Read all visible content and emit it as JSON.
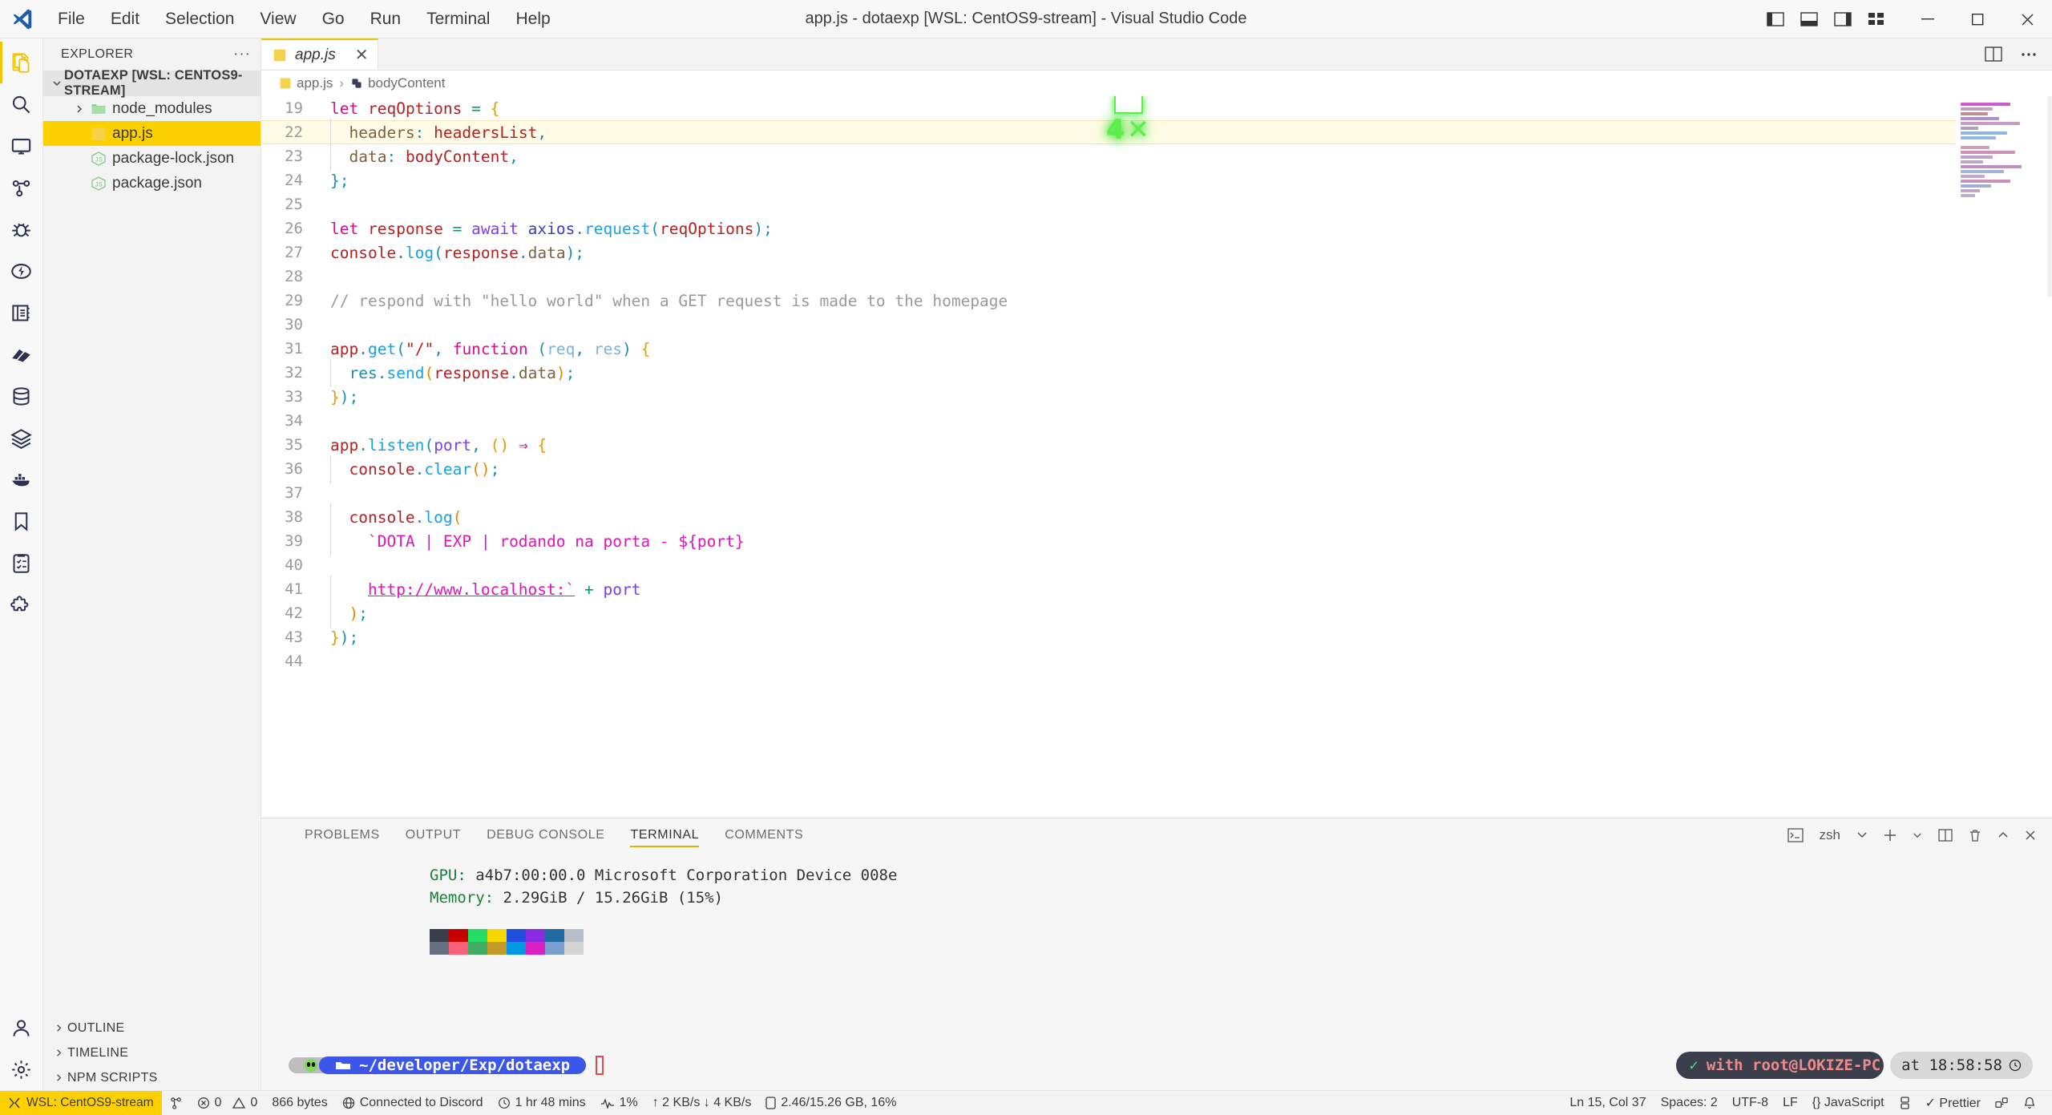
{
  "window": {
    "title": "app.js - dotaexp [WSL: CentOS9-stream] - Visual Studio Code",
    "menu": [
      "File",
      "Edit",
      "Selection",
      "View",
      "Go",
      "Run",
      "Terminal",
      "Help"
    ]
  },
  "activitybar": {
    "items": [
      {
        "name": "explorer-icon",
        "label": "Explorer",
        "active": true
      },
      {
        "name": "search-icon",
        "label": "Search",
        "active": false
      },
      {
        "name": "remote-explorer-icon",
        "label": "Remote Explorer",
        "active": false
      },
      {
        "name": "source-control-icon",
        "label": "Source Control",
        "active": false
      },
      {
        "name": "run-debug-icon",
        "label": "Run and Debug",
        "active": false
      },
      {
        "name": "thunder-client-icon",
        "label": "Thunder Client",
        "active": false
      },
      {
        "name": "notebook-icon",
        "label": "Notebook",
        "active": false
      },
      {
        "name": "books-icon",
        "label": "Docs",
        "active": false
      },
      {
        "name": "database-icon",
        "label": "Database",
        "active": false
      },
      {
        "name": "layers-icon",
        "label": "Layers",
        "active": false
      },
      {
        "name": "docker-icon",
        "label": "Docker",
        "active": false
      },
      {
        "name": "bookmark-icon",
        "label": "Bookmarks",
        "active": false
      },
      {
        "name": "todo-tree-icon",
        "label": "Todo Tree",
        "active": false
      },
      {
        "name": "extensions-icon",
        "label": "Extensions",
        "active": false
      }
    ],
    "bottom": [
      {
        "name": "accounts-icon",
        "label": "Accounts"
      },
      {
        "name": "gear-icon",
        "label": "Manage"
      }
    ]
  },
  "sidebar": {
    "header": "EXPLORER",
    "more_actions": "···",
    "root": "DOTAEXP [WSL: CENTOS9-STREAM]",
    "items": [
      {
        "label": "node_modules",
        "icon": "folder-icon",
        "expandable": true,
        "selected": false,
        "indent": 1
      },
      {
        "label": "app.js",
        "icon": "js-file-icon",
        "expandable": false,
        "selected": true,
        "indent": 2
      },
      {
        "label": "package-lock.json",
        "icon": "node-file-icon",
        "expandable": false,
        "selected": false,
        "indent": 2
      },
      {
        "label": "package.json",
        "icon": "node-file-icon",
        "expandable": false,
        "selected": false,
        "indent": 2
      }
    ],
    "sections": [
      "OUTLINE",
      "TIMELINE",
      "NPM SCRIPTS"
    ]
  },
  "editor": {
    "tab": {
      "label": "app.js",
      "icon": "js-file-icon",
      "close": "✕"
    },
    "breadcrumbs": [
      {
        "label": "app.js",
        "icon": "js-file-icon"
      },
      {
        "label": "bodyContent",
        "icon": "symbol-variable-icon"
      }
    ],
    "click_badge": "4",
    "click_badge_suffix": "✕",
    "cursor_line": 22,
    "lines": [
      {
        "n": "19",
        "text": "let reqOptions = {"
      },
      {
        "n": "22",
        "text": "  headers: headersList,"
      },
      {
        "n": "23",
        "text": "  data: bodyContent,"
      },
      {
        "n": "24",
        "text": "};"
      },
      {
        "n": "25",
        "text": ""
      },
      {
        "n": "26",
        "text": "let response = await axios.request(reqOptions);"
      },
      {
        "n": "27",
        "text": "console.log(response.data);"
      },
      {
        "n": "28",
        "text": ""
      },
      {
        "n": "29",
        "text": "// respond with \"hello world\" when a GET request is made to the homepage"
      },
      {
        "n": "30",
        "text": ""
      },
      {
        "n": "31",
        "text": "app.get(\"/\", function (req, res) {"
      },
      {
        "n": "32",
        "text": "  res.send(response.data);"
      },
      {
        "n": "33",
        "text": "});"
      },
      {
        "n": "34",
        "text": ""
      },
      {
        "n": "35",
        "text": "app.listen(port, () ⇒ {"
      },
      {
        "n": "36",
        "text": "  console.clear();"
      },
      {
        "n": "37",
        "text": ""
      },
      {
        "n": "38",
        "text": "  console.log("
      },
      {
        "n": "39",
        "text": "    `DOTA | EXP | rodando na porta - ${port}"
      },
      {
        "n": "40",
        "text": ""
      },
      {
        "n": "41",
        "text": "    http://www.localhost:` + port"
      },
      {
        "n": "42",
        "text": "  );"
      },
      {
        "n": "43",
        "text": "});"
      },
      {
        "n": "44",
        "text": ""
      }
    ]
  },
  "panel": {
    "tabs": [
      {
        "label": "PROBLEMS",
        "active": false
      },
      {
        "label": "OUTPUT",
        "active": false
      },
      {
        "label": "DEBUG CONSOLE",
        "active": false
      },
      {
        "label": "TERMINAL",
        "active": true
      },
      {
        "label": "COMMENTS",
        "active": false
      }
    ],
    "shell": "zsh",
    "actions": [
      "split-terminal-icon",
      "new-terminal-icon",
      "chevron-down-icon",
      "split-icon",
      "kill-terminal-icon",
      "chevron-up-icon",
      "close-icon"
    ],
    "terminal": {
      "lines": [
        {
          "label": "GPU:",
          "value": " a4b7:00:00.0 Microsoft Corporation Device 008e"
        },
        {
          "label": "Memory:",
          "value": " 2.29GiB / 15.26GiB (15%)"
        }
      ],
      "swatches_top": [
        "#3a3f4b",
        "#c60000",
        "#22dd66",
        "#f5d800",
        "#1f4fe0",
        "#8a2be2",
        "#1f6a9e",
        "#b9bfc6"
      ],
      "swatches_bottom": [
        "#667080",
        "#f9617b",
        "#43aa63",
        "#c49a2a",
        "#0098e0",
        "#d81fc0",
        "#7a9fd0",
        "#d4d4d4"
      ],
      "prompt": {
        "avatar": "alien-icon",
        "folder_icon": "folder-icon",
        "path": "~/developer/Exp/dotaexp",
        "cursor": "block-cursor"
      },
      "right_status": {
        "check": "✓",
        "user": "with root@LOKIZE-PC",
        "at": "at 18:58:58",
        "clock": "clock-icon"
      }
    }
  },
  "statusbar": {
    "remote": {
      "icon": "remote-icon",
      "label": "WSL: CentOS9-stream"
    },
    "left": [
      {
        "icon": "source-control-icon",
        "label": ""
      },
      {
        "icon": "error-icon",
        "label": "0",
        "icon2": "warning-icon",
        "label2": "0"
      },
      {
        "icon": "",
        "label": "866 bytes"
      },
      {
        "icon": "globe-icon",
        "label": "Connected to Discord"
      },
      {
        "icon": "clock-icon",
        "label": "1 hr 48 mins"
      },
      {
        "icon": "pulse-icon",
        "label": "1%"
      },
      {
        "icon": "network-icon",
        "label": "↑ 2 KB/s ↓ 4 KB/s"
      },
      {
        "icon": "disk-icon",
        "label": "2.46/15.26 GB, 16%"
      }
    ],
    "right": [
      {
        "label": "Ln 15, Col 37"
      },
      {
        "label": "Spaces: 2"
      },
      {
        "label": "UTF-8"
      },
      {
        "label": "LF"
      },
      {
        "label": "{} JavaScript"
      },
      {
        "icon": "port-icon",
        "label": ""
      },
      {
        "label": "✓ Prettier"
      },
      {
        "icon": "remote-hub-icon",
        "label": ""
      },
      {
        "icon": "bell-icon",
        "label": ""
      }
    ]
  },
  "colors": {
    "accent_yellow": "#fdd000",
    "tab_active_border": "#f0c400",
    "selection": "#fdd000",
    "terminal_prompt_blue": "#3b56e8",
    "badge_green": "#5cf04a"
  }
}
